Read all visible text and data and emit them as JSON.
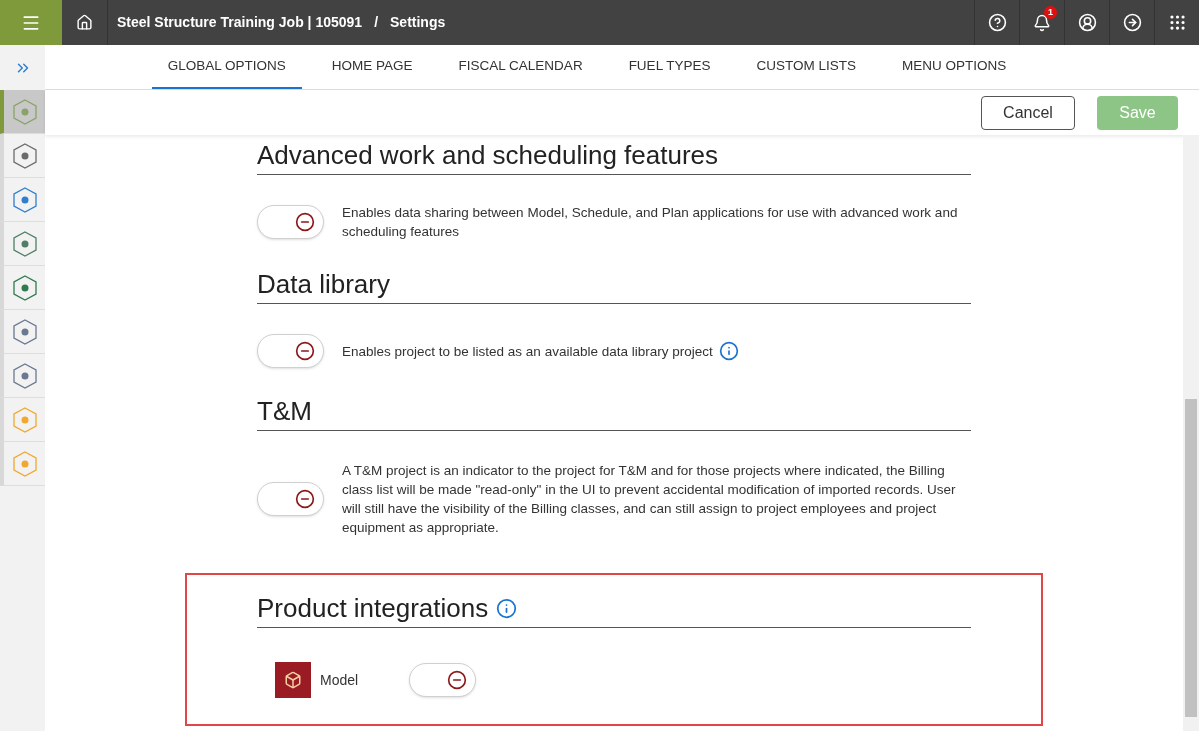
{
  "header": {
    "breadcrumb_project": "Steel Structure Training Job | 105091",
    "breadcrumb_separator": "/",
    "breadcrumb_page": "Settings",
    "notification_count": "1"
  },
  "tabs": [
    {
      "label": "GLOBAL OPTIONS",
      "selected": true
    },
    {
      "label": "HOME PAGE",
      "selected": false
    },
    {
      "label": "FISCAL CALENDAR",
      "selected": false
    },
    {
      "label": "FUEL TYPES",
      "selected": false
    },
    {
      "label": "CUSTOM LISTS",
      "selected": false
    },
    {
      "label": "MENU OPTIONS",
      "selected": false
    }
  ],
  "sidebar": {
    "items": [
      {
        "selected": true,
        "color": "#8aa36a"
      },
      {
        "selected": false,
        "color": "#6b6b6b"
      },
      {
        "selected": false,
        "color": "#2f7fd0"
      },
      {
        "selected": false,
        "color": "#4f7f66"
      },
      {
        "selected": false,
        "color": "#2f7a4f"
      },
      {
        "selected": false,
        "color": "#6a7890"
      },
      {
        "selected": false,
        "color": "#6a7890"
      },
      {
        "selected": false,
        "color": "#f0a830"
      },
      {
        "selected": false,
        "color": "#f0a830"
      }
    ]
  },
  "actions": {
    "cancel": "Cancel",
    "save": "Save",
    "save_disabled": true
  },
  "sections": [
    {
      "title": "Advanced work and scheduling features",
      "rows": [
        {
          "kind": "toggle",
          "on": false,
          "text": "Enables data sharing between Model, Schedule, and Plan applications for use with advanced work and scheduling features"
        }
      ]
    },
    {
      "title": "Data library",
      "rows": [
        {
          "kind": "toggle",
          "on": false,
          "text": "Enables project to be listed as an available data library project",
          "info": true
        }
      ]
    },
    {
      "title": "T&M",
      "rows": [
        {
          "kind": "toggle",
          "on": false,
          "text": "A T&M project is an indicator to the project for T&M and for those projects where indicated, the Billing class list will be made \"read-only\" in the UI to prevent accidental modification of imported records. User will still have the visibility of the Billing classes, and can still assign to project employees and project equipment as appropriate."
        }
      ]
    },
    {
      "title": "Product integrations",
      "info": true,
      "highlighted": true,
      "rows": [
        {
          "kind": "product",
          "on": false,
          "text": "Model"
        }
      ]
    }
  ]
}
